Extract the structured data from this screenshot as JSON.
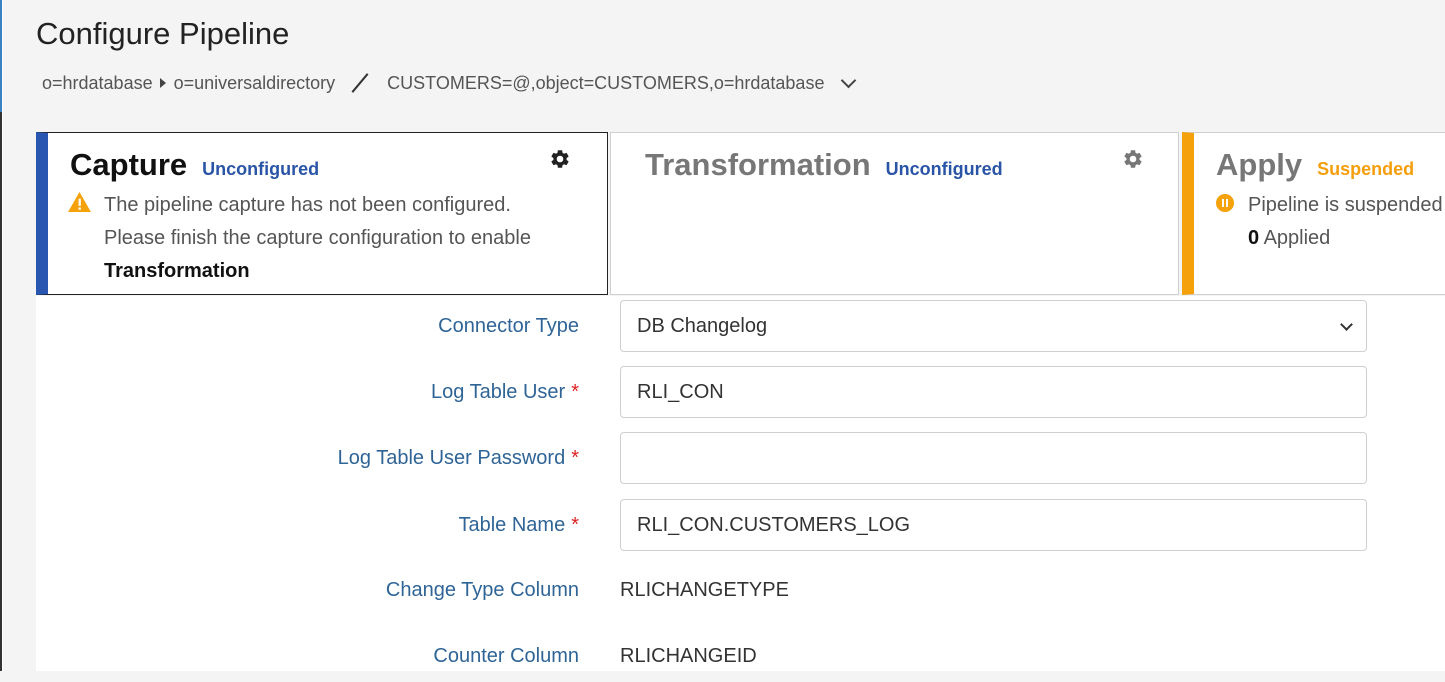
{
  "page": {
    "title": "Configure Pipeline"
  },
  "breadcrumb": {
    "items": [
      "o=hrdatabase",
      "o=universaldirectory"
    ],
    "current": "CUSTOMERS=@,object=CUSTOMERS,o=hrdatabase"
  },
  "cards": {
    "capture": {
      "title": "Capture",
      "status": "Unconfigured",
      "message_line1": "The pipeline capture has not been configured.",
      "message_line2": "Please finish the capture configuration to enable",
      "message_line3": "Transformation"
    },
    "transformation": {
      "title": "Transformation",
      "status": "Unconfigured"
    },
    "apply": {
      "title": "Apply",
      "status": "Suspended",
      "message": "Pipeline is suspended",
      "applied_count": "0",
      "applied_label": "Applied"
    }
  },
  "form": {
    "connector_type": {
      "label": "Connector Type",
      "value": "DB Changelog"
    },
    "log_table_user": {
      "label": "Log Table User",
      "value": "RLI_CON"
    },
    "log_table_password": {
      "label": "Log Table User Password",
      "value": ""
    },
    "table_name": {
      "label": "Table Name",
      "value": "RLI_CON.CUSTOMERS_LOG"
    },
    "change_type_column": {
      "label": "Change Type Column",
      "value": "RLICHANGETYPE"
    },
    "counter_column": {
      "label": "Counter Column",
      "value": "RLICHANGEID"
    },
    "required_marker": "*"
  },
  "colors": {
    "capture_accent": "#2856b0",
    "apply_accent": "#f5a10a",
    "status_unconfigured": "#2a55a6",
    "status_suspended": "#f59e0b",
    "label": "#2f6496",
    "required": "#dd2222"
  },
  "icons": {
    "breadcrumb_separator": "caret-right-icon",
    "breadcrumb_divider": "slash-icon",
    "breadcrumb_toggle": "chevron-down-icon",
    "card_settings": "gear-icon",
    "capture_warning": "warning-icon",
    "apply_state": "pause-icon",
    "select_toggle": "chevron-down-icon"
  }
}
